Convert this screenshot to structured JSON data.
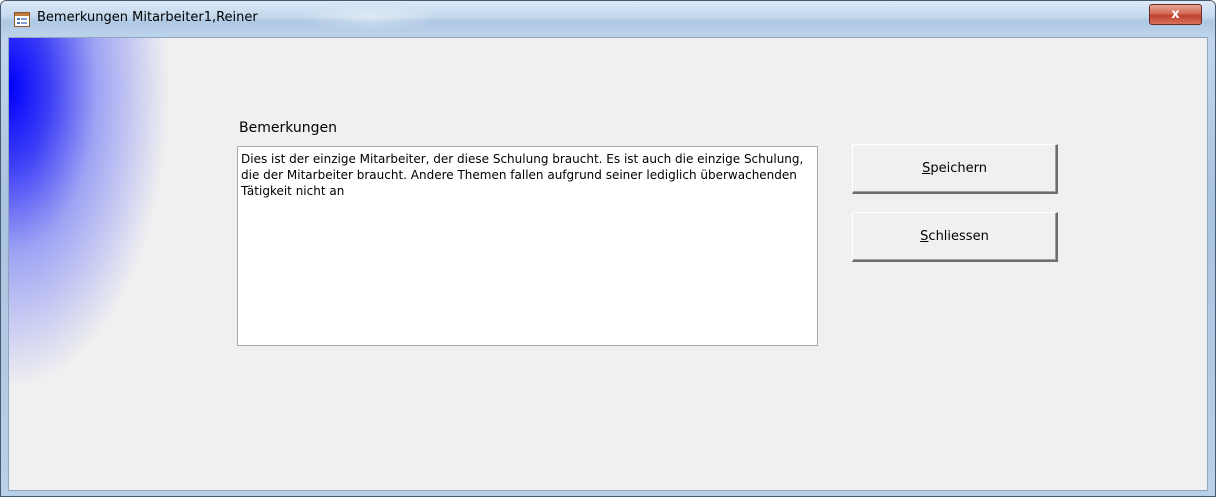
{
  "window": {
    "title": "Bemerkungen Mitarbeiter1,Reiner",
    "close_glyph": "x",
    "icon": "form-icon",
    "close_icon": "close-icon"
  },
  "form": {
    "field_label": "Bemerkungen",
    "remarks_value": "Dies ist der einzige Mitarbeiter, der diese Schulung braucht. Es ist auch die einzige Schulung, die der Mitarbeiter braucht. Andere Themen fallen aufgrund seiner lediglich überwachenden Tätigkeit nicht an"
  },
  "buttons": {
    "save": {
      "accel": "S",
      "rest": "peichern"
    },
    "close": {
      "accel": "S",
      "rest": "chliessen"
    }
  },
  "colors": {
    "accent_blue": "#0000ff",
    "close_button_red": "#c0412d",
    "form_background": "#f0f0f0"
  }
}
